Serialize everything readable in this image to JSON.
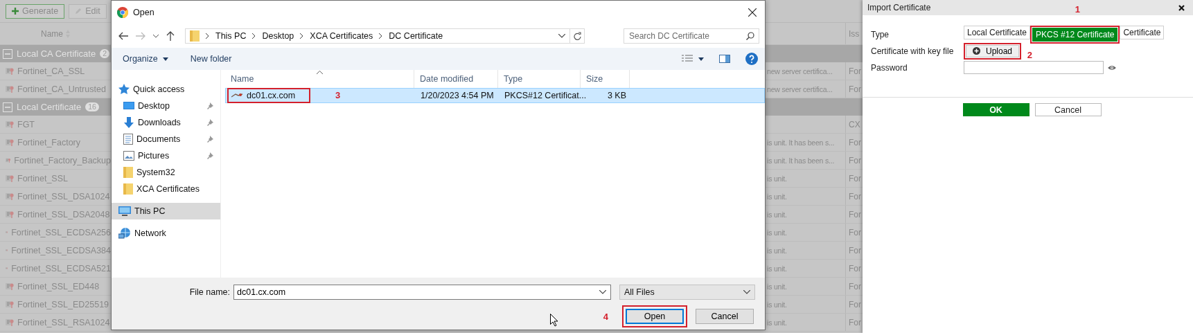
{
  "background": {
    "toolbar": [
      {
        "label": "Generate",
        "disabled": false
      },
      {
        "label": "Edit",
        "disabled": true
      }
    ],
    "columns": [
      "Name",
      "Iss"
    ],
    "groups": [
      {
        "label": "Local CA Certificate",
        "count": "2",
        "expanded": true,
        "rows": [
          {
            "name": "Fortinet_CA_SSL",
            "comments": "new server certifica...",
            "issuer": "For"
          },
          {
            "name": "Fortinet_CA_Untrusted",
            "comments": "new server certifica...",
            "issuer": "For"
          }
        ]
      },
      {
        "label": "Local Certificate",
        "count": "16",
        "expanded": true,
        "rows": [
          {
            "name": "FGT",
            "issuer": "CX"
          },
          {
            "name": "Fortinet_Factory",
            "comments": "is unit. It has been s...",
            "issuer": "For"
          },
          {
            "name": "Fortinet_Factory_Backup",
            "comments": "is unit. It has been s...",
            "issuer": "For"
          },
          {
            "name": "Fortinet_SSL",
            "comments": "is unit.",
            "issuer": "For"
          },
          {
            "name": "Fortinet_SSL_DSA1024",
            "comments": "is unit.",
            "issuer": "For"
          },
          {
            "name": "Fortinet_SSL_DSA2048",
            "comments": "is unit.",
            "issuer": "For"
          },
          {
            "name": "Fortinet_SSL_ECDSA256",
            "comments": "is unit.",
            "issuer": "For"
          },
          {
            "name": "Fortinet_SSL_ECDSA384",
            "comments": "is unit.",
            "issuer": "For"
          },
          {
            "name": "Fortinet_SSL_ECDSA521",
            "comments": "is unit.",
            "issuer": "For"
          },
          {
            "name": "Fortinet_SSL_ED448",
            "comments": "is unit.",
            "issuer": "For"
          },
          {
            "name": "Fortinet_SSL_ED25519",
            "comments": "is unit.",
            "issuer": "For"
          },
          {
            "name": "Fortinet_SSL_RSA1024",
            "comments": "is unit.",
            "issuer": "For"
          }
        ]
      }
    ]
  },
  "dialog": {
    "title": "Open",
    "path": [
      "This PC",
      "Desktop",
      "XCA Certificates",
      "DC Certificate"
    ],
    "search": {
      "placeholder": "Search DC Certificate"
    },
    "toolbar": {
      "organize": "Organize",
      "new_folder": "New folder"
    },
    "nav": [
      {
        "label": "Quick access",
        "selected": false,
        "pinned": false,
        "children": [
          {
            "label": "Desktop",
            "selected": false,
            "pinned": true
          },
          {
            "label": "Downloads",
            "selected": false,
            "pinned": true
          },
          {
            "label": "Documents",
            "selected": false,
            "pinned": true
          },
          {
            "label": "Pictures",
            "selected": false,
            "pinned": true
          },
          {
            "label": "System32",
            "selected": false,
            "pinned": false
          },
          {
            "label": "XCA Certificates",
            "selected": false,
            "pinned": false
          }
        ]
      },
      {
        "label": "This PC",
        "selected": true,
        "pinned": false
      },
      {
        "label": "Network",
        "selected": false,
        "pinned": false
      }
    ],
    "columns": [
      "Name",
      "Date modified",
      "Type",
      "Size"
    ],
    "files": [
      {
        "name": "dc01.cx.com",
        "date": "1/20/2023 4:54 PM",
        "type": "PKCS#12 Certificat...",
        "size": "3 KB",
        "selected": true,
        "callout": "3"
      }
    ],
    "file_name": {
      "label": "File name:",
      "value": "dc01.cx.com"
    },
    "filter": "All Files",
    "buttons": [
      {
        "label": "Open",
        "default": true,
        "callout": "4"
      },
      {
        "label": "Cancel",
        "default": false
      }
    ]
  },
  "import_panel": {
    "title": "Import Certificate",
    "fields": [
      {
        "kind": "segmented",
        "label": "Type",
        "options": [
          {
            "label": "Local Certificate",
            "selected": false
          },
          {
            "label": "PKCS #12 Certificate",
            "selected": true,
            "callout": "1"
          },
          {
            "label": "Certificate",
            "selected": false
          }
        ]
      },
      {
        "kind": "upload",
        "label": "Certificate with key file",
        "button": "Upload",
        "callout": "2"
      },
      {
        "kind": "password",
        "label": "Password"
      }
    ],
    "buttons": [
      {
        "label": "OK",
        "primary": true
      },
      {
        "label": "Cancel",
        "primary": false
      }
    ]
  }
}
